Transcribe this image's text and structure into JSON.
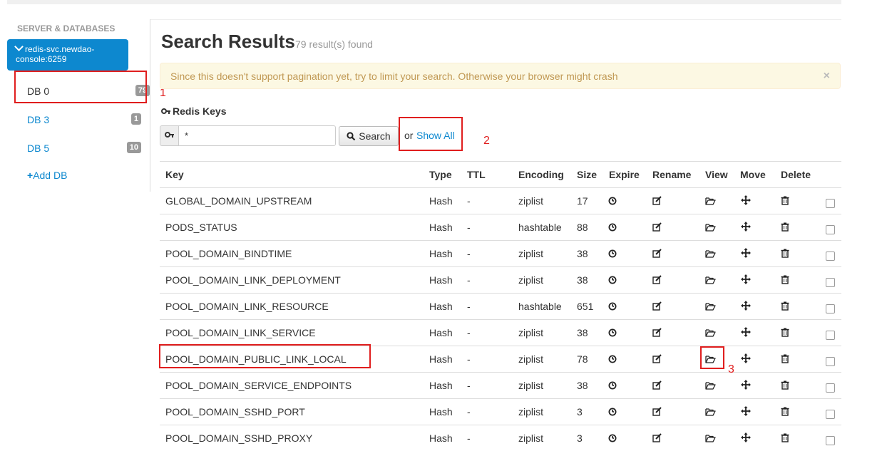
{
  "sidebar": {
    "header": "SERVER & DATABASES",
    "server": "redis-svc.newdao-console:6259",
    "databases": [
      {
        "label": "DB 0",
        "count": "79"
      },
      {
        "label": "DB 3",
        "count": "1"
      },
      {
        "label": "DB 5",
        "count": "10"
      }
    ],
    "add_db": "Add DB"
  },
  "main": {
    "title": "Search Results",
    "subtitle": "79 result(s) found",
    "alert": "Since this doesn't support pagination yet, try to limit your search. Otherwise your browser might crash",
    "alert_close": "×",
    "keys_label": "Redis Keys",
    "search_value": "*",
    "search_button": "Search",
    "or_text": "or",
    "show_all": "Show All"
  },
  "annotations": [
    "1",
    "2",
    "3"
  ],
  "table": {
    "headers": [
      "Key",
      "Type",
      "TTL",
      "Encoding",
      "Size",
      "Expire",
      "Rename",
      "View",
      "Move",
      "Delete"
    ],
    "rows": [
      {
        "key": "GLOBAL_DOMAIN_UPSTREAM",
        "type": "Hash",
        "ttl": "-",
        "encoding": "ziplist",
        "size": "17"
      },
      {
        "key": "PODS_STATUS",
        "type": "Hash",
        "ttl": "-",
        "encoding": "hashtable",
        "size": "88"
      },
      {
        "key": "POOL_DOMAIN_BINDTIME",
        "type": "Hash",
        "ttl": "-",
        "encoding": "ziplist",
        "size": "38"
      },
      {
        "key": "POOL_DOMAIN_LINK_DEPLOYMENT",
        "type": "Hash",
        "ttl": "-",
        "encoding": "ziplist",
        "size": "38"
      },
      {
        "key": "POOL_DOMAIN_LINK_RESOURCE",
        "type": "Hash",
        "ttl": "-",
        "encoding": "hashtable",
        "size": "651"
      },
      {
        "key": "POOL_DOMAIN_LINK_SERVICE",
        "type": "Hash",
        "ttl": "-",
        "encoding": "ziplist",
        "size": "38"
      },
      {
        "key": "POOL_DOMAIN_PUBLIC_LINK_LOCAL",
        "type": "Hash",
        "ttl": "-",
        "encoding": "ziplist",
        "size": "78"
      },
      {
        "key": "POOL_DOMAIN_SERVICE_ENDPOINTS",
        "type": "Hash",
        "ttl": "-",
        "encoding": "ziplist",
        "size": "38"
      },
      {
        "key": "POOL_DOMAIN_SSHD_PORT",
        "type": "Hash",
        "ttl": "-",
        "encoding": "ziplist",
        "size": "3"
      },
      {
        "key": "POOL_DOMAIN_SSHD_PROXY",
        "type": "Hash",
        "ttl": "-",
        "encoding": "ziplist",
        "size": "3"
      }
    ]
  },
  "icons": {
    "expire": "clock-icon",
    "rename": "edit-icon",
    "view": "folder-open-icon",
    "move": "move-icon",
    "delete": "trash-icon"
  },
  "colors": {
    "accent": "#0d88cf",
    "annotation_red": "#e01e1e",
    "alert_bg": "#fcf8e3",
    "alert_text": "#c09853"
  }
}
